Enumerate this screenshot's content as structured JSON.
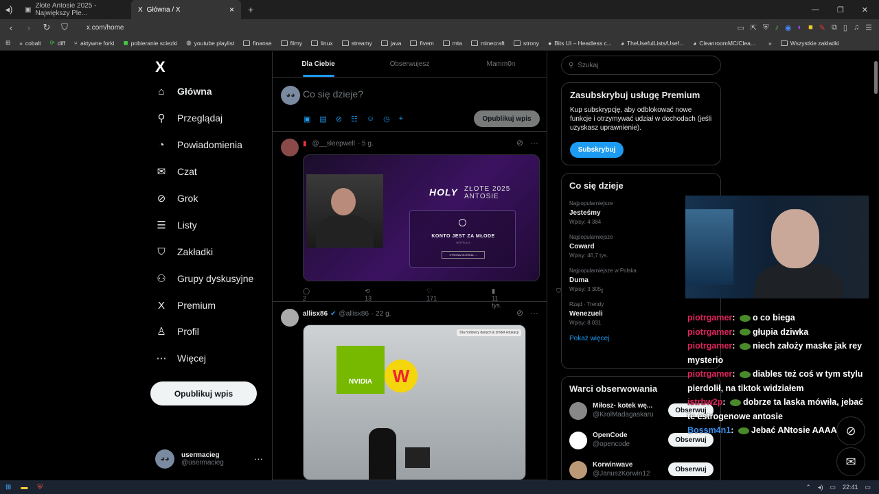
{
  "browser": {
    "tabs": [
      {
        "label": "Złote Antosie 2025 - Największy Ple...",
        "favicon": "page-icon"
      },
      {
        "label": "Główna / X",
        "favicon": "x-icon"
      }
    ],
    "new_tab": "+",
    "url": "x.com/home",
    "bookmarks": [
      "cobalt",
      "diff",
      "aktywne forki",
      "pobieranie sciezki",
      "youtube playlist",
      "finanse",
      "filmy",
      "linux",
      "streamy",
      "java",
      "fivem",
      "mta",
      "minecraft",
      "strony",
      "Bits UI – Headless c...",
      "TheUsefulLists/Usef...",
      "CleanroomMC/Clea..."
    ],
    "all_bookmarks": "Wszystkie zakładki",
    "clock": "22:41"
  },
  "sidebar": {
    "logo": "X",
    "items": [
      {
        "label": "Główna",
        "icon": "home-icon",
        "glyph": "⌂"
      },
      {
        "label": "Przeglądaj",
        "icon": "search-icon",
        "glyph": "⚲"
      },
      {
        "label": "Powiadomienia",
        "icon": "bell-icon",
        "glyph": "◔"
      },
      {
        "label": "Czat",
        "icon": "mail-icon",
        "glyph": "✉"
      },
      {
        "label": "Grok",
        "icon": "grok-icon",
        "glyph": "⊘"
      },
      {
        "label": "Listy",
        "icon": "list-icon",
        "glyph": "☰"
      },
      {
        "label": "Zakładki",
        "icon": "bookmark-icon",
        "glyph": "⛉"
      },
      {
        "label": "Grupy dyskusyjne",
        "icon": "community-icon",
        "glyph": "⚇"
      },
      {
        "label": "Premium",
        "icon": "x-premium-icon",
        "glyph": "X"
      },
      {
        "label": "Profil",
        "icon": "profile-icon",
        "glyph": "♙"
      },
      {
        "label": "Więcej",
        "icon": "more-icon",
        "glyph": "⋯"
      }
    ],
    "post_button": "Opublikuj wpis",
    "account": {
      "name": "usermacieg",
      "handle": "@usermacieg",
      "menu": "···"
    }
  },
  "feed": {
    "tabs": [
      "Dla Ciebie",
      "Obserwujesz",
      "Mamm0n"
    ],
    "compose_placeholder": "Co się dzieje?",
    "publish_button": "Opublikuj wpis",
    "tweets": [
      {
        "name": "",
        "handle": "@__sleepwell",
        "time": "· 5 g.",
        "media_title": "HOLY",
        "media_subtitle": "ZŁOTE 2025 ANTOSIE",
        "media_box": "KONTO JEST ZA MŁODE",
        "media_box_small": "WITTR #13",
        "media_button": "STRONA GŁÓWNA →",
        "replies": "2",
        "reposts": "13",
        "likes": "171",
        "views": "11 tys."
      },
      {
        "name": "allisx86",
        "handle": "@allisx86",
        "time": "· 22 g.",
        "media_brand": "NVIDIA",
        "media_coin": "W",
        "media_badge": "Dla hodowcy danych & źródeł edukacji"
      }
    ]
  },
  "right": {
    "search_placeholder": "Szukaj",
    "premium": {
      "title": "Zasubskrybuj usługę Premium",
      "desc": "Kup subskrypcję, aby odblokować nowe funkcje i otrzymywać udział w dochodach (jeśli uzyskasz uprawnienie).",
      "button": "Subskrybuj"
    },
    "trends": {
      "title": "Co się dzieje",
      "items": [
        {
          "context": "Najpopularniejsze",
          "name": "Jesteśmy",
          "count": "Wpisy: 4 384"
        },
        {
          "context": "Najpopularniejsze",
          "name": "Coward",
          "count": "Wpisy: 46,7 tys."
        },
        {
          "context": "Najpopularniejsze w Polska",
          "name": "Duma",
          "count": "Wpisy: 3 305"
        },
        {
          "context": "Rząd · Trendy",
          "name": "Wenezueli",
          "count": "Wpisy: 8 031"
        }
      ],
      "more": "Pokaż więcej"
    },
    "follow": {
      "title": "Warci obserwowania",
      "items": [
        {
          "name": "Miłosz- kotek wę...",
          "handle": "@KrolMadagaskaru",
          "button": "Obserwuj"
        },
        {
          "name": "OpenCode",
          "handle": "@opencode",
          "button": "Obserwuj"
        },
        {
          "name": "Korwinwave",
          "handle": "@JanuszKorwin12",
          "button": "Obserwuj"
        }
      ]
    }
  },
  "overlay_chat": [
    {
      "user": "piotrgamer",
      "text": "o co biega"
    },
    {
      "user": "piotrgamer",
      "text": "głupia dziwka"
    },
    {
      "user": "piotrgamer",
      "text": "niech założy maske jak rey mysterio"
    },
    {
      "user": "piotrgamer",
      "text": "diables też coś w tym stylu pierdolił, na tiktok widziałem"
    },
    {
      "user": "istrbw2p",
      "text": "dobrze ta laska mówiła, jebać te estrogenowe antosie"
    },
    {
      "user": "Bossm4n1",
      "text": "Jebać ANtosie AAAA"
    }
  ]
}
